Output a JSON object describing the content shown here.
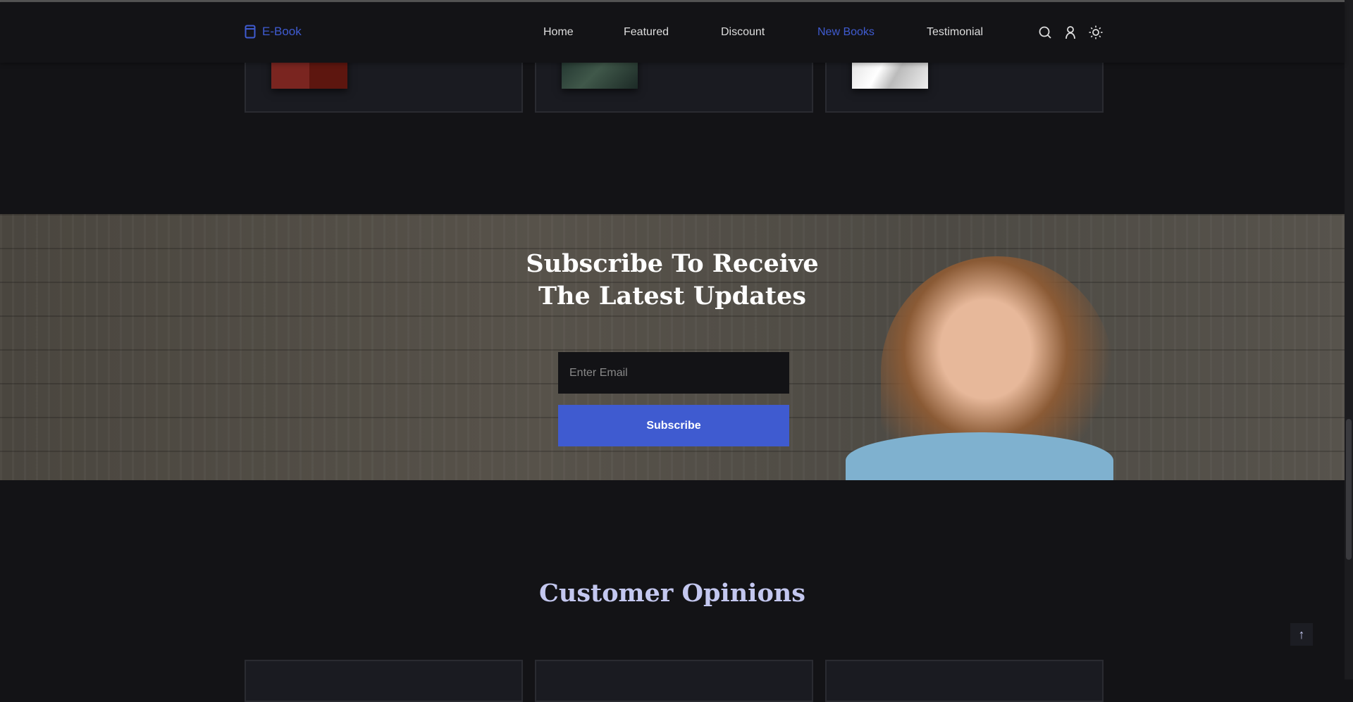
{
  "header": {
    "logo": "E-Book",
    "nav": [
      "Home",
      "Featured",
      "Discount",
      "New Books",
      "Testimonial"
    ],
    "active": "New Books",
    "icons": [
      "search-icon",
      "user-icon",
      "sun-icon"
    ]
  },
  "subscribe": {
    "title_line1": "Subscribe To Receive",
    "title_line2": "The Latest Updates",
    "email_placeholder": "Enter Email",
    "button": "Subscribe"
  },
  "opinions": {
    "title": "Customer Opinions"
  },
  "colors": {
    "accent": "#3f5bd0",
    "background": "#131316",
    "heading": "#c3c7ef"
  }
}
